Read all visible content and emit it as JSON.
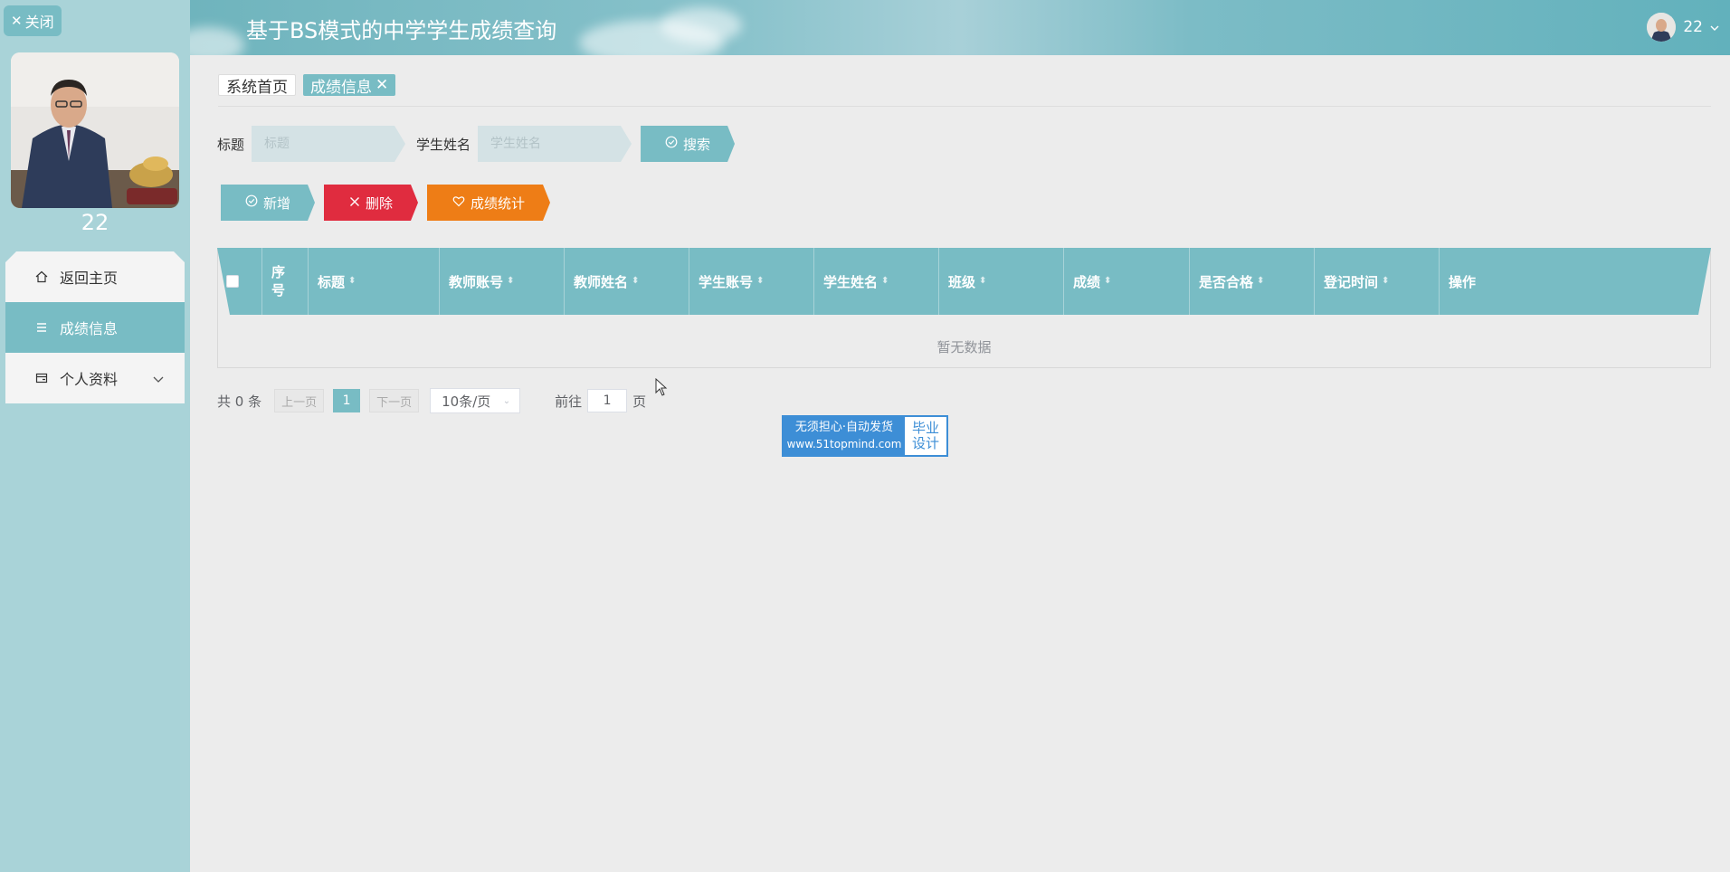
{
  "sidebar": {
    "close_label": "关闭",
    "user_name": "22",
    "menu": [
      {
        "label": "返回主页",
        "icon": "home-icon"
      },
      {
        "label": "成绩信息",
        "icon": "list-icon"
      },
      {
        "label": "个人资料",
        "icon": "profile-icon"
      }
    ]
  },
  "header": {
    "title": "基于BS模式的中学学生成绩查询",
    "user": "22"
  },
  "tags": {
    "home": "系统首页",
    "current": "成绩信息"
  },
  "search": {
    "title_label": "标题",
    "title_placeholder": "标题",
    "student_label": "学生姓名",
    "student_placeholder": "学生姓名",
    "button": "搜索"
  },
  "actions": {
    "add": "新增",
    "delete": "删除",
    "stats": "成绩统计"
  },
  "table": {
    "columns": [
      "序号",
      "标题",
      "教师账号",
      "教师姓名",
      "学生账号",
      "学生姓名",
      "班级",
      "成绩",
      "是否合格",
      "登记时间",
      "操作"
    ],
    "empty_text": "暂无数据"
  },
  "pager": {
    "total": "共 0 条",
    "prev": "上一页",
    "current": "1",
    "next": "下一页",
    "page_size": "10条/页",
    "goto_prefix": "前往",
    "goto_value": "1",
    "goto_suffix": "页"
  },
  "logo": {
    "line1": "无须担心·自动发货",
    "line2": "www.51topmind.com",
    "right1": "毕业",
    "right2": "设计"
  },
  "colors": {
    "accent": "#78bcc4",
    "danger": "#e02c3f",
    "warning": "#ee7d16",
    "sidebar": "#a9d3d8"
  }
}
